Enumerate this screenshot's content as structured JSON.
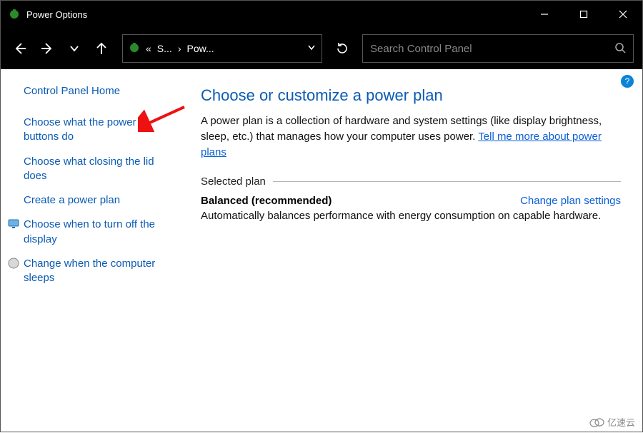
{
  "window": {
    "title": "Power Options"
  },
  "breadcrumb": {
    "seg1": "S...",
    "seg2": "Pow..."
  },
  "search": {
    "placeholder": "Search Control Panel"
  },
  "sidebar": {
    "home": "Control Panel Home",
    "links": [
      {
        "label": "Choose what the power buttons do",
        "icon": null
      },
      {
        "label": "Choose what closing the lid does",
        "icon": null
      },
      {
        "label": "Create a power plan",
        "icon": null
      },
      {
        "label": "Choose when to turn off the display",
        "icon": "monitor"
      },
      {
        "label": "Change when the computer sleeps",
        "icon": "moon"
      }
    ]
  },
  "main": {
    "heading": "Choose or customize a power plan",
    "description_prefix": "A power plan is a collection of hardware and system settings (like display brightness, sleep, etc.) that manages how your computer uses power. ",
    "description_link": "Tell me more about power plans",
    "section_label": "Selected plan",
    "plan": {
      "name": "Balanced (recommended)",
      "change_link": "Change plan settings",
      "description": "Automatically balances performance with energy consumption on capable hardware."
    }
  },
  "help_badge": "?",
  "watermark": "亿速云"
}
